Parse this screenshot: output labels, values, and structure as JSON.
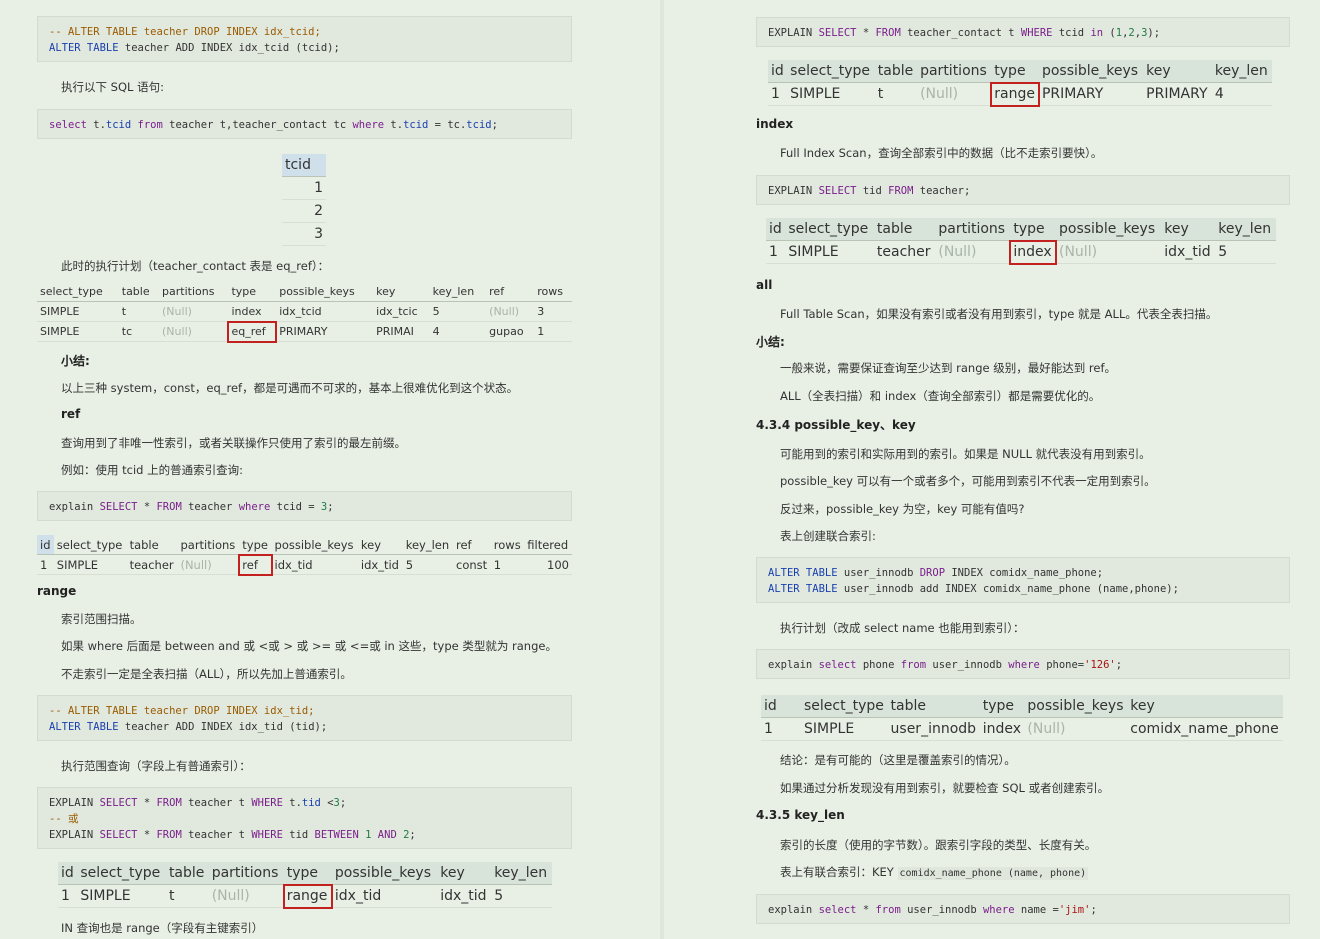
{
  "left": {
    "code1": [
      "-- ALTER TABLE teacher DROP INDEX idx_tcid;",
      "ALTER TABLE teacher ADD INDEX idx_tcid (tcid);"
    ],
    "p_exec_sql": "执行以下 SQL 语句:",
    "code2": "select t.tcid from teacher t,teacher_contact tc where t.tcid = tc.tcid;",
    "tcid_table": {
      "header": "tcid",
      "rows": [
        "1",
        "2",
        "3"
      ]
    },
    "p_plan": "此时的执行计划（teacher_contact 表是 eq_ref）：",
    "eqref_table": {
      "headers": [
        "select_type",
        "table",
        "partitions",
        "type",
        "possible_keys",
        "key",
        "key_len",
        "ref",
        "rows"
      ],
      "rows": [
        [
          "SIMPLE",
          "t",
          "(Null)",
          "index",
          "idx_tcid",
          "idx_tcic",
          "5",
          "(Null)",
          "3"
        ],
        [
          "SIMPLE",
          "tc",
          "(Null)",
          "eq_ref",
          "PRIMARY",
          "PRIMAI",
          "4",
          "gupao",
          "1"
        ]
      ]
    },
    "h_summary": "小结:",
    "p_summary": "以上三种 system，const，eq_ref，都是可遇而不可求的，基本上很难优化到这个状态。",
    "h_ref": "ref",
    "p_ref1": "查询用到了非唯一性索引，或者关联操作只使用了索引的最左前缀。",
    "p_ref2": "例如：使用 tcid 上的普通索引查询:",
    "code3": "explain SELECT * FROM teacher where tcid = 3;",
    "ref_table": {
      "headers": [
        "id",
        "select_type",
        "table",
        "partitions",
        "type",
        "possible_keys",
        "key",
        "key_len",
        "ref",
        "rows",
        "filtered"
      ],
      "row": [
        "1",
        "SIMPLE",
        "teacher",
        "(Null)",
        "ref",
        "idx_tid",
        "idx_tid",
        "5",
        "const",
        "1",
        "100"
      ]
    },
    "h_range": "range",
    "p_range1": "索引范围扫描。",
    "p_range2": "如果 where 后面是 between and 或 <或 > 或 >= 或 <=或 in 这些，type 类型就为 range。",
    "p_range3": "不走索引一定是全表扫描（ALL），所以先加上普通索引。",
    "code4": [
      "-- ALTER TABLE teacher DROP INDEX idx_tid;",
      "ALTER TABLE teacher ADD INDEX idx_tid (tid);"
    ],
    "p_range4": "执行范围查询（字段上有普通索引）：",
    "code5": [
      "EXPLAIN SELECT * FROM teacher t WHERE t.tid <3;",
      "-- 或",
      "EXPLAIN SELECT * FROM teacher t WHERE tid BETWEEN 1 AND 2;"
    ],
    "range_table": {
      "headers": [
        "id",
        "select_type",
        "table",
        "partitions",
        "type",
        "possible_keys",
        "key",
        "key_len"
      ],
      "row": [
        "1",
        "SIMPLE",
        "t",
        "(Null)",
        "range",
        "idx_tid",
        "idx_tid",
        "5"
      ]
    },
    "p_in": "IN 查询也是 range（字段有主键索引）"
  },
  "right": {
    "code_in": "EXPLAIN SELECT * FROM teacher_contact t WHERE tcid in (1,2,3);",
    "in_table": {
      "headers": [
        "id",
        "select_type",
        "table",
        "partitions",
        "type",
        "possible_keys",
        "key",
        "key_len"
      ],
      "row": [
        "1",
        "SIMPLE",
        "t",
        "(Null)",
        "range",
        "PRIMARY",
        "PRIMARY",
        "4"
      ]
    },
    "h_index": "index",
    "p_index": "Full Index Scan，查询全部索引中的数据（比不走索引要快）。",
    "code_index": "EXPLAIN SELECT tid FROM teacher;",
    "index_table": {
      "headers": [
        "id",
        "select_type",
        "table",
        "partitions",
        "type",
        "possible_keys",
        "key",
        "key_len"
      ],
      "row": [
        "1",
        "SIMPLE",
        "teacher",
        "(Null)",
        "index",
        "(Null)",
        "idx_tid",
        "5"
      ]
    },
    "h_all": "all",
    "p_all": "Full Table Scan，如果没有索引或者没有用到索引，type 就是 ALL。代表全表扫描。",
    "h_summary": "小结:",
    "p_sum1": "一般来说，需要保证查询至少达到 range 级别，最好能达到 ref。",
    "p_sum2": "ALL（全表扫描）和 index（查询全部索引）都是需要优化的。",
    "h_434": "4.3.4 possible_key、key",
    "p_434a": "可能用到的索引和实际用到的索引。如果是 NULL 就代表没有用到索引。",
    "p_434b": "possible_key 可以有一个或者多个，可能用到索引不代表一定用到索引。",
    "p_434c": "反过来，possible_key 为空，key 可能有值吗?",
    "p_434d": "表上创建联合索引:",
    "code_alter": [
      "ALTER TABLE user_innodb DROP INDEX comidx_name_phone;",
      "ALTER TABLE user_innodb add INDEX comidx_name_phone (name,phone);"
    ],
    "p_plan2": "执行计划（改成 select name 也能用到索引）：",
    "code_phone": "explain select phone from user_innodb where phone='126';",
    "phone_table": {
      "headers": [
        "id",
        "select_type",
        "table",
        "type",
        "possible_keys",
        "key"
      ],
      "row": [
        "1",
        "SIMPLE",
        "user_innodb",
        "index",
        "(Null)",
        "comidx_name_phone"
      ]
    },
    "p_concl1": "结论：是有可能的（这里是覆盖索引的情况）。",
    "p_concl2": "如果通过分析发现没有用到索引，就要检查 SQL 或者创建索引。",
    "h_435": "4.3.5 key_len",
    "p_435a": "索引的长度（使用的字节数）。跟索引字段的类型、长度有关。",
    "p_435b_pre": "表上有联合索引：KEY",
    "p_435b_code": "comidx_name_phone (name, phone)",
    "code_last": "explain select * from user_innodb where name ='jim';"
  }
}
